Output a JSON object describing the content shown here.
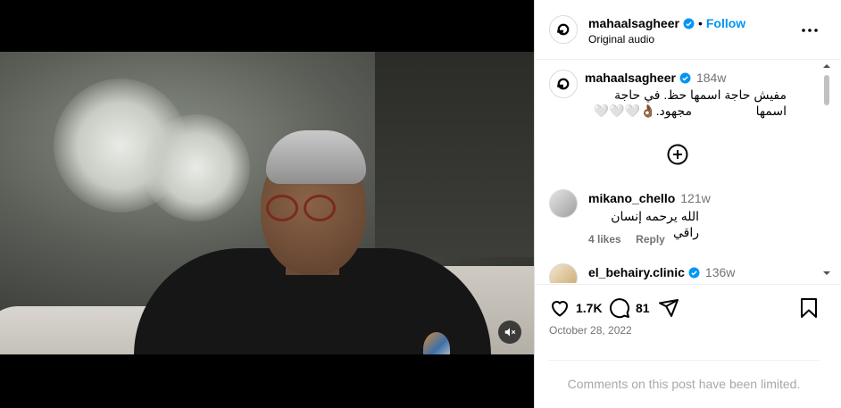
{
  "post": {
    "username": "mahaalsagheer",
    "follow_label": "Follow",
    "separator": "•",
    "audio_label": "Original audio"
  },
  "caption": {
    "username": "mahaalsagheer",
    "time": "184w",
    "line1": "مفيش حاجة اسمها حظ. في حاجة اسمها",
    "line2": "مجهود.👌🏾🤍🤍🤍"
  },
  "comments": [
    {
      "username": "mikano_chello",
      "time": "121w",
      "text": "الله يرحمه إنسان راقي",
      "likes": "4 likes",
      "reply_label": "Reply"
    },
    {
      "username": "el_behairy.clinic",
      "time": "136w"
    }
  ],
  "actions": {
    "likes_count": "1.7K",
    "comments_count": "81"
  },
  "date": "October 28, 2022",
  "limited_notice": "Comments on this post have been limited.",
  "colors": {
    "accent": "#0095f6",
    "verified": "#0095f6",
    "muted_text": "#737373"
  },
  "icons": [
    "more-options-icon",
    "verified-badge-icon",
    "add-comment-icon",
    "heart-icon",
    "comment-icon",
    "share-icon",
    "bookmark-icon",
    "muted-audio-icon"
  ]
}
